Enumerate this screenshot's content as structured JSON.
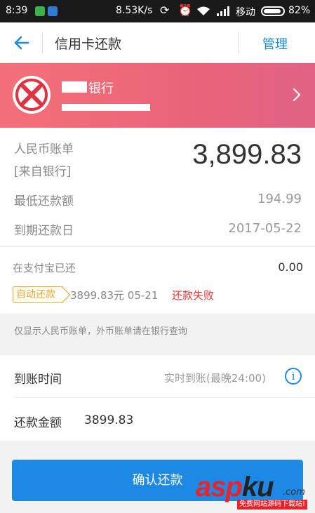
{
  "status_bar": {
    "time": "8:39",
    "net_speed": "8.53K/s",
    "carrier": "移动",
    "battery": "82%"
  },
  "header": {
    "title": "信用卡还款",
    "manage_label": "管理"
  },
  "bank": {
    "name": "银行"
  },
  "bill": {
    "rmb_label": "人民币账单",
    "source_label": "[来自银行]",
    "rmb_amount": "3,899.83",
    "min_label": "最低还款额",
    "min_amount": "194.99",
    "due_label": "到期还款日",
    "due_date": "2017-05-22"
  },
  "paid": {
    "label": "在支付宝已还",
    "value": "0.00",
    "auto_tag": "自动还款",
    "auto_detail": "3899.83元 05-21",
    "auto_status": "还款失败"
  },
  "note": "仅显示人民币账单，外币账单请在银行查询",
  "arrival": {
    "label": "到账时间",
    "value": "实时到账(最晚24:00)"
  },
  "amount": {
    "label": "还款金额",
    "value": "3899.83"
  },
  "confirm_label": "确认还款",
  "watermark": {
    "asp": "asp",
    "ku": "ku",
    "dot_com": ".com",
    "sub": "免费网站源码下载站!"
  },
  "colors": {
    "accent": "#1e88e5",
    "bank_card": "#ea6479",
    "tag": "#f5a623",
    "error": "#e53935"
  }
}
